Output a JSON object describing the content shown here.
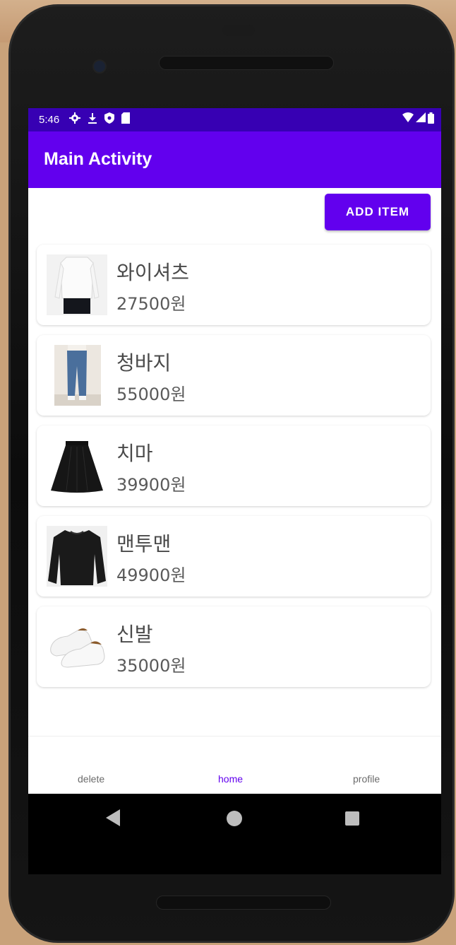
{
  "status_bar": {
    "time": "5:46",
    "left_icons": [
      "gear-icon",
      "download-icon",
      "shield-icon",
      "sd-card-icon"
    ],
    "right_icons": [
      "wifi-icon",
      "signal-icon",
      "battery-icon"
    ]
  },
  "app_bar": {
    "title": "Main Activity"
  },
  "toolbar": {
    "add_item_label": "ADD ITEM"
  },
  "items": [
    {
      "name": "와이셔츠",
      "price": "27500원",
      "image": "shirt"
    },
    {
      "name": "청바지",
      "price": "55000원",
      "image": "jeans"
    },
    {
      "name": "치마",
      "price": "39900원",
      "image": "skirt"
    },
    {
      "name": "맨투맨",
      "price": "49900원",
      "image": "sweatshirt"
    },
    {
      "name": "신발",
      "price": "35000원",
      "image": "sneakers"
    }
  ],
  "bottom_nav": [
    {
      "label": "delete",
      "active": false
    },
    {
      "label": "home",
      "active": true
    },
    {
      "label": "profile",
      "active": false
    }
  ],
  "colors": {
    "primary": "#6200ee",
    "status_bar": "#3700b3"
  }
}
